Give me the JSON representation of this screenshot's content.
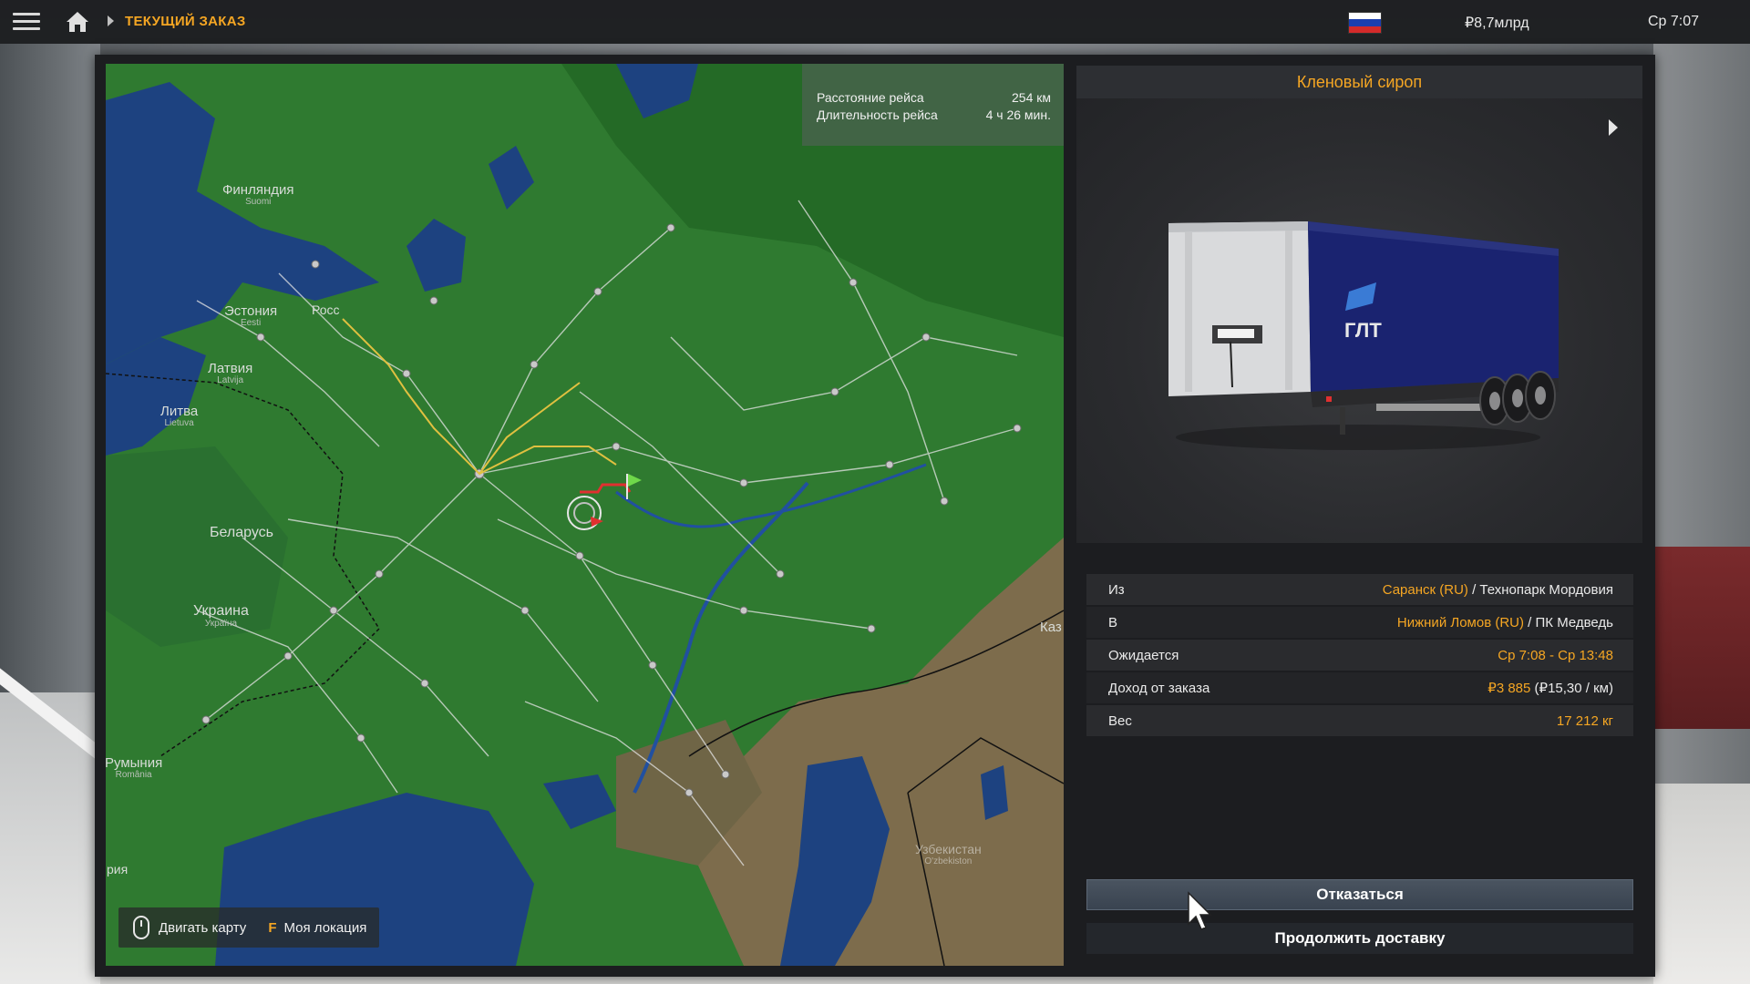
{
  "topbar": {
    "breadcrumb_title": "ТЕКУЩИЙ ЗАКАЗ",
    "money": "₽8,7млрд",
    "clock": "Ср 7:07",
    "flag_colors": [
      "#ffffff",
      "#1c3fb0",
      "#d42a2a"
    ],
    "icons": [
      "menu-icon",
      "home-icon",
      "chevron-right-icon",
      "russia-flag-icon"
    ]
  },
  "map": {
    "info": {
      "distance_label": "Расстояние рейса",
      "distance_value": "254 км",
      "duration_label": "Длительность рейса",
      "duration_value": "4 ч 26 мин."
    },
    "labels": {
      "finland": "Финляндия",
      "finland_local": "Suomi",
      "estonia": "Эстония",
      "estonia_local": "Eesti",
      "russia_short": "Росс",
      "latvia": "Латвия",
      "latvia_local": "Latvija",
      "lithuania": "Литва",
      "lithuania_local": "Lietuva",
      "belarus": "Беларусь",
      "ukraine": "Украина",
      "ukraine_local": "Україна",
      "kaz": "Каз",
      "romania": "Румыния",
      "romania_local": "România",
      "uzbekistan": "Узбекистан",
      "uzbekistan_local": "O'zbekiston",
      "bottom_left": "рия"
    },
    "controls": {
      "move_map": "Двигать карту",
      "key": "F",
      "my_location": "Моя локация"
    },
    "colors": {
      "land": "#2f7a30",
      "water": "#1c3f7a",
      "desert": "#7a6a4a",
      "route": "#e0c040"
    }
  },
  "cargo": {
    "title": "Кленовый сироп",
    "trailer_brand": "ГЛТ"
  },
  "details": {
    "from_label": "Из",
    "from_city": "Саранск (RU)",
    "from_company": " / Технопарк Мордовия",
    "to_label": "В",
    "to_city": "Нижний Ломов (RU)",
    "to_company": " / ПК Медведь",
    "expected_label": "Ожидается",
    "expected_value": "Ср 7:08 - Ср 13:48",
    "income_label": "Доход от заказа",
    "income_value": "₽3 885",
    "income_rate": " (₽15,30 / км)",
    "weight_label": "Вес",
    "weight_value": "17 212 кг"
  },
  "buttons": {
    "decline": "Отказаться",
    "continue": "Продолжить доставку"
  }
}
